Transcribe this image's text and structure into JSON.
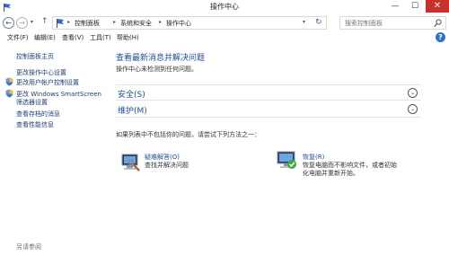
{
  "window": {
    "title": "操作中心",
    "min": "—",
    "max": "☐",
    "close": "✕"
  },
  "address": {
    "back": "←",
    "forward": "→",
    "recent": "▾",
    "up": "↑",
    "crumbs": [
      "控制面板",
      "系统和安全",
      "操作中心"
    ],
    "sep": "▸",
    "dropdown": "▾",
    "refresh": "↻",
    "search_placeholder": "搜索控制面板"
  },
  "menu": [
    "文件(F)",
    "编辑(E)",
    "查看(V)",
    "工具(T)",
    "帮助(H)"
  ],
  "help": "?",
  "left": {
    "home": "控制面板主页",
    "links": [
      "更改操作中心设置",
      "更改用户帐户控制设置",
      "更改 Windows SmartScreen",
      "筛选器设置",
      "查看存档的消息",
      "查看性能信息"
    ],
    "see_also": "另请参阅"
  },
  "main": {
    "title": "查看最新消息并解决问题",
    "subtitle": "操作中心未检测到任何问题。",
    "sections": [
      {
        "label": "安全(S)",
        "chev": "⌄"
      },
      {
        "label": "维护(M)",
        "chev": "⌄"
      }
    ],
    "try_text": "如果列表中不包括你的问题，请尝试下列方法之一：",
    "options": [
      {
        "title": "疑难解答(O)",
        "desc": "查找并解决问题"
      },
      {
        "title": "恢复(R)",
        "desc": "恢复电脑而不影响文件，或者初始化电脑并重新开始。"
      }
    ]
  },
  "colors": {
    "link": "#1e4e99",
    "close": "#c7302d",
    "accent": "#2b73c9"
  }
}
